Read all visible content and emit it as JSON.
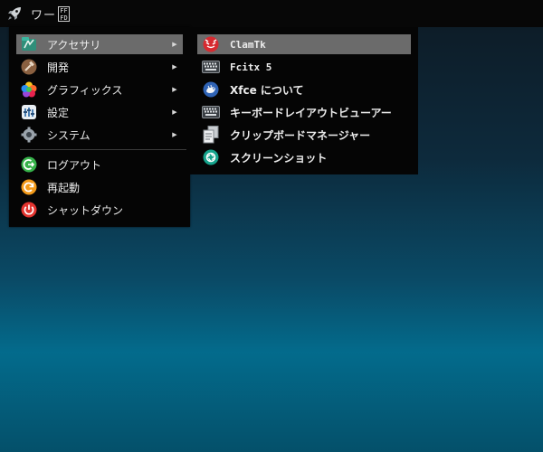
{
  "panel": {
    "workspace_label": "ワー",
    "ff_glyph_top": "FF",
    "ff_glyph_bottom": "FD",
    "launcher_icon": "rocket-icon"
  },
  "main_menu": {
    "items": [
      {
        "label": "アクセサリ",
        "icon": "accessories-icon",
        "has_submenu": true,
        "selected": true
      },
      {
        "label": "開発",
        "icon": "development-icon",
        "has_submenu": true
      },
      {
        "label": "グラフィックス",
        "icon": "graphics-icon",
        "has_submenu": true
      },
      {
        "label": "設定",
        "icon": "settings-icon",
        "has_submenu": true
      },
      {
        "label": "システム",
        "icon": "system-icon",
        "has_submenu": true
      },
      {
        "label": "ログアウト",
        "icon": "logout-icon",
        "has_submenu": false
      },
      {
        "label": "再起動",
        "icon": "restart-icon",
        "has_submenu": false
      },
      {
        "label": "シャットダウン",
        "icon": "shutdown-icon",
        "has_submenu": false
      }
    ],
    "arrow": "▶"
  },
  "sub_menu": {
    "items": [
      {
        "label": "ClamTk",
        "icon": "clamtk-icon",
        "selected": true
      },
      {
        "label": "Fcitx 5",
        "icon": "keyboard-icon"
      },
      {
        "label": "Xfce について",
        "icon": "xfce-icon"
      },
      {
        "label": "キーボードレイアウトビューアー",
        "icon": "keyboard-layout-icon"
      },
      {
        "label": "クリップボードマネージャー",
        "icon": "clipboard-icon"
      },
      {
        "label": "スクリーンショット",
        "icon": "screenshot-icon"
      }
    ]
  },
  "colors": {
    "selected_bg": "#6b6b6b",
    "menu_bg": "#050505",
    "panel_bg": "#070707"
  }
}
